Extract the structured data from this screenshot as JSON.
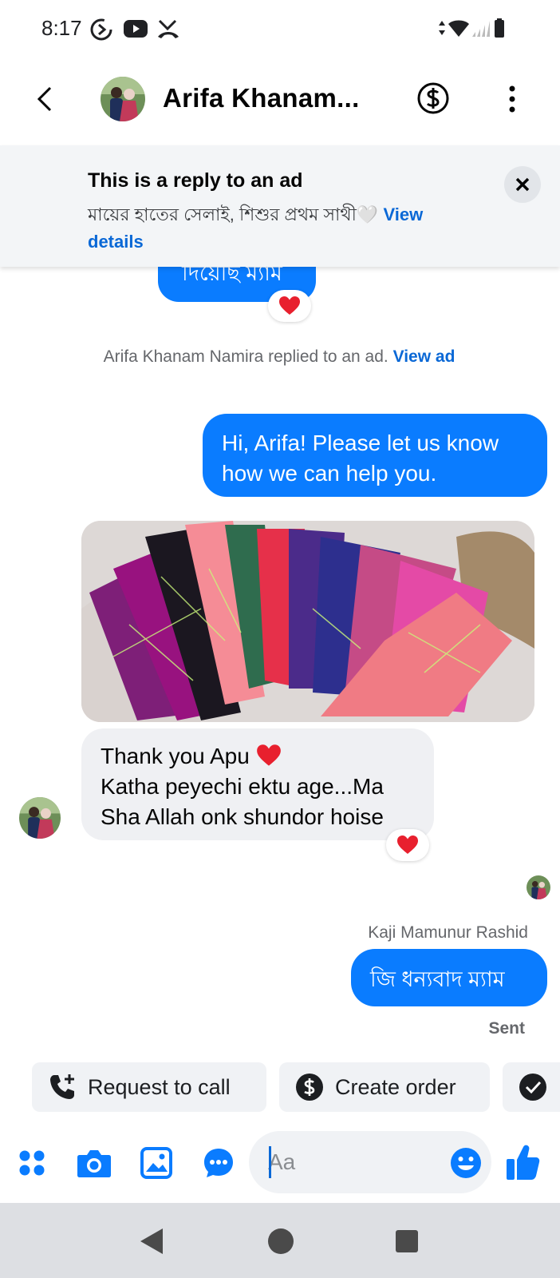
{
  "status_bar": {
    "time": "8:17"
  },
  "header": {
    "contact_name": "Arifa Khanam..."
  },
  "ad_banner": {
    "title": "This is a reply to an ad",
    "description": "মায়ের হাতের সেলাই, শিশুর প্রথম সাথী🤍",
    "link": "View details"
  },
  "messages": {
    "partial_sent": "দিয়েছি ম্যাম",
    "system_text": "Arifa Khanam Namira replied to an ad.",
    "system_link": "View ad",
    "welcome": "Hi, Arifa! Please let us know how we can help you.",
    "received_line1": "Thank you Apu",
    "received_line2": "Katha peyechi ektu age...Ma",
    "received_line3": "Sha Allah onk shundor hoise",
    "sender_name": "Kaji Mamunur Rashid",
    "last_sent": "জি ধন্যবাদ ম্যাম",
    "status": "Sent"
  },
  "quick_actions": [
    {
      "label": "Request to call"
    },
    {
      "label": "Create order"
    }
  ],
  "composer": {
    "placeholder": "Aa"
  },
  "colors": {
    "accent": "#0a7cff",
    "link": "#0a68d6",
    "bubble_gray": "#eff0f3",
    "reaction": "#e8202e"
  },
  "icons": [
    "back-icon",
    "dollar-icon",
    "more-icon",
    "close-icon",
    "heart-icon",
    "phone-plus-icon",
    "check-icon",
    "apps-icon",
    "camera-icon",
    "gallery-icon",
    "chat-bubble-icon",
    "emoji-icon",
    "thumbs-up-icon"
  ]
}
